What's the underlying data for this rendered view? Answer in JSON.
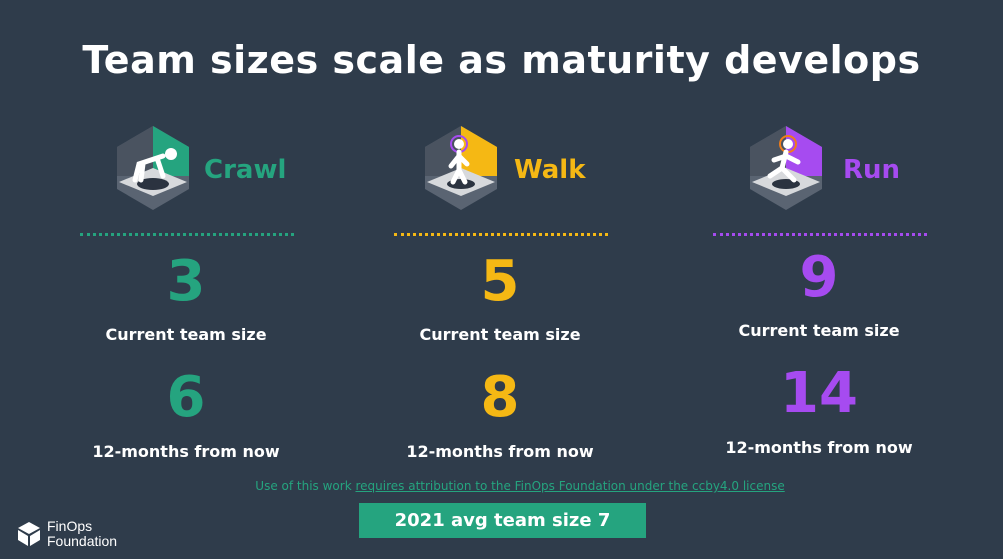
{
  "title": "Team sizes scale as maturity develops",
  "stages": [
    {
      "name": "Crawl",
      "current_value": "3",
      "current_label": "Current team size",
      "future_value": "6",
      "future_label": "12-months from now",
      "color": "#25a47f",
      "icon": "crawling-person-icon"
    },
    {
      "name": "Walk",
      "current_value": "5",
      "current_label": "Current team size",
      "future_value": "8",
      "future_label": "12-months from now",
      "color": "#f5b814",
      "icon": "walking-person-icon"
    },
    {
      "name": "Run",
      "current_value": "9",
      "current_label": "Current team size",
      "future_value": "14",
      "future_label": "12-months from now",
      "color": "#a64bf0",
      "icon": "running-person-icon"
    }
  ],
  "attribution": {
    "prefix": "Use of this work ",
    "link_text": "requires attribution to the FinOps Foundation under the ccby4.0 license"
  },
  "avg_banner": "2021 avg team size 7",
  "logo": {
    "line1": "FinOps",
    "line2": "Foundation"
  },
  "colors": {
    "background": "#2f3c4b",
    "crawl": "#25a47f",
    "walk": "#f5b814",
    "run": "#a64bf0"
  }
}
